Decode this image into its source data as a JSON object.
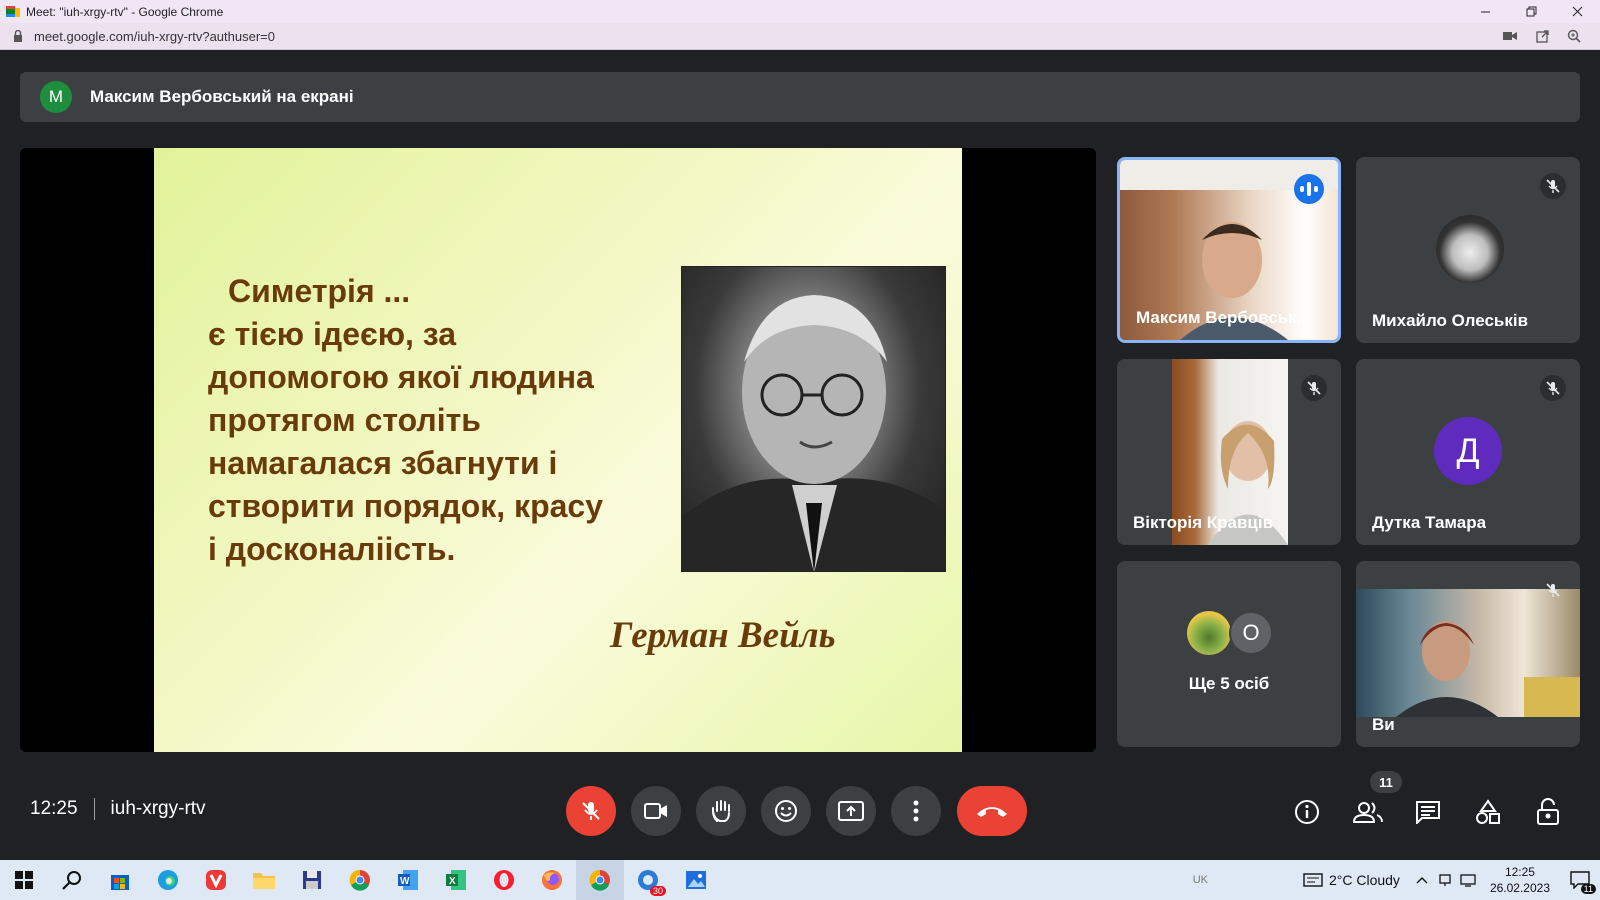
{
  "window": {
    "title": "Meet: \"iuh-xrgy-rtv\" - Google Chrome",
    "url": "meet.google.com/iuh-xrgy-rtv?authuser=0"
  },
  "banner": {
    "avatar_letter": "M",
    "text": "Максим Вербовський на екрані"
  },
  "slide": {
    "quote_lines": [
      "Симетрія ...",
      "є тією ідеєю, за",
      "допомогою якої людина",
      "протягом століть",
      "намагалася збагнути і",
      "створити порядок, красу",
      "і досконаліість."
    ],
    "author": "Герман Вейль"
  },
  "participants": [
    {
      "name": "Максим Вербовськ...",
      "state": "speaking"
    },
    {
      "name": "Михайло Олеськів",
      "state": "muted"
    },
    {
      "name": "Вікторія Кравців",
      "state": "muted"
    },
    {
      "name": "Дутка Тамара",
      "state": "muted",
      "avatar_letter": "Д"
    },
    {
      "name": "Ще 5 осіб",
      "avatar_letter": "O"
    },
    {
      "name": "Ви",
      "state": "muted"
    }
  ],
  "controls": {
    "time": "12:25",
    "meeting_code": "iuh-xrgy-rtv",
    "participant_count": "11"
  },
  "taskbar": {
    "lang": "UK",
    "weather": "2°C  Cloudy",
    "time": "12:25",
    "date": "26.02.2023",
    "notifications": "11",
    "opera_badge": "30"
  },
  "colors": {
    "accent_blue": "#8ab4f8",
    "hangup_red": "#ea4335",
    "surface": "#3c4043",
    "background": "#202124",
    "slide_text": "#6a3b0a"
  }
}
